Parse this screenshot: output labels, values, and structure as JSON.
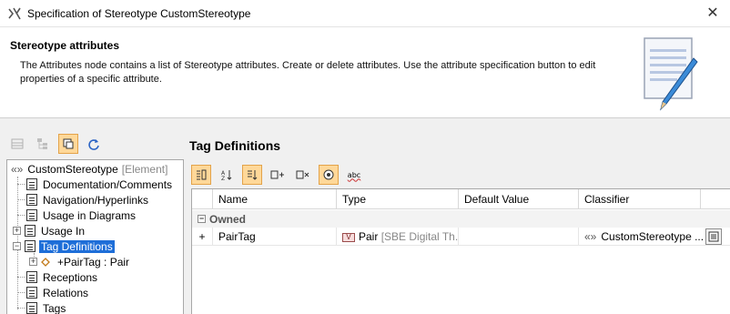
{
  "window": {
    "title": "Specification of Stereotype CustomStereotype",
    "close_glyph": "✕"
  },
  "header": {
    "title": "Stereotype attributes",
    "description": "The Attributes node contains a list of Stereotype attributes. Create or delete attributes. Use the attribute specification button to edit properties of a specific attribute."
  },
  "left_toolbar": {
    "icons": [
      "grid-view-icon",
      "tree-view-icon",
      "compact-view-icon",
      "refresh-icon"
    ]
  },
  "tree": {
    "root": {
      "label": "CustomStereotype",
      "meta": "[Element]",
      "prefix": "«»"
    },
    "items": [
      {
        "label": "Documentation/Comments"
      },
      {
        "label": "Navigation/Hyperlinks"
      },
      {
        "label": "Usage in Diagrams"
      },
      {
        "label": "Usage In",
        "expander": "+"
      },
      {
        "label": "Tag Definitions",
        "expander": "−",
        "selected": true
      },
      {
        "label": "+PairTag : Pair",
        "expander": "+",
        "child": true
      },
      {
        "label": "Receptions"
      },
      {
        "label": "Relations"
      },
      {
        "label": "Tags"
      }
    ]
  },
  "right_panel": {
    "title": "Tag Definitions",
    "toolbar_icons": [
      "group-by-icon",
      "sort-alpha-icon",
      "sort-order-icon",
      "add-attribute-icon",
      "remove-attribute-icon",
      "show-inherited-icon",
      "spelling-icon"
    ],
    "spelling_label": "abc"
  },
  "grid": {
    "columns": [
      "Name",
      "Type",
      "Default Value",
      "Classifier"
    ],
    "group": {
      "label": "Owned",
      "expander": "−"
    },
    "rows": [
      {
        "marker": "+",
        "name": "PairTag",
        "type_icon_letter": "V",
        "type": "Pair",
        "type_extra": "[SBE Digital Th...",
        "default_value": "",
        "classifier_prefix": "«»",
        "classifier": "CustomStereotype ..."
      }
    ]
  },
  "colors": {
    "selection": "#1e6ed8",
    "active_button": "#ffd899",
    "active_button_border": "#e3a34a"
  }
}
